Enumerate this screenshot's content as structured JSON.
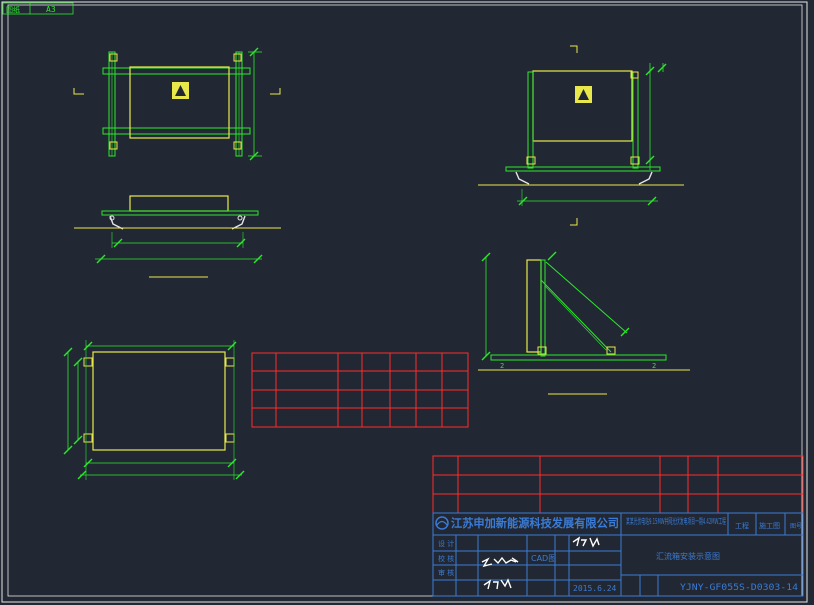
{
  "sheet": {
    "corner_label": "图纸",
    "size": "A3"
  },
  "title_block": {
    "company": "江苏申加新能源科技发展有限公司",
    "project": "某某光伏电站9.15MW并网光伏发电项目一期4.42MW工程",
    "stage_label": "工程",
    "stage_value": "施工图",
    "section_label": "图号",
    "drawing_title": "汇流箱安装示意图",
    "row_labels": [
      "设 计",
      "校 核",
      "审 核"
    ],
    "cad_label": "CAD图",
    "date": "2015.6.24",
    "drawing_number": "YJNY-GF055S-D0303-14"
  },
  "colors": {
    "background": "#222833",
    "cad_green": "#2be82b",
    "cad_yellow": "#e8e84a",
    "cad_red": "#ff2b2b",
    "cad_white": "#e6e6e6",
    "cad_blue": "#3a7bd5"
  }
}
